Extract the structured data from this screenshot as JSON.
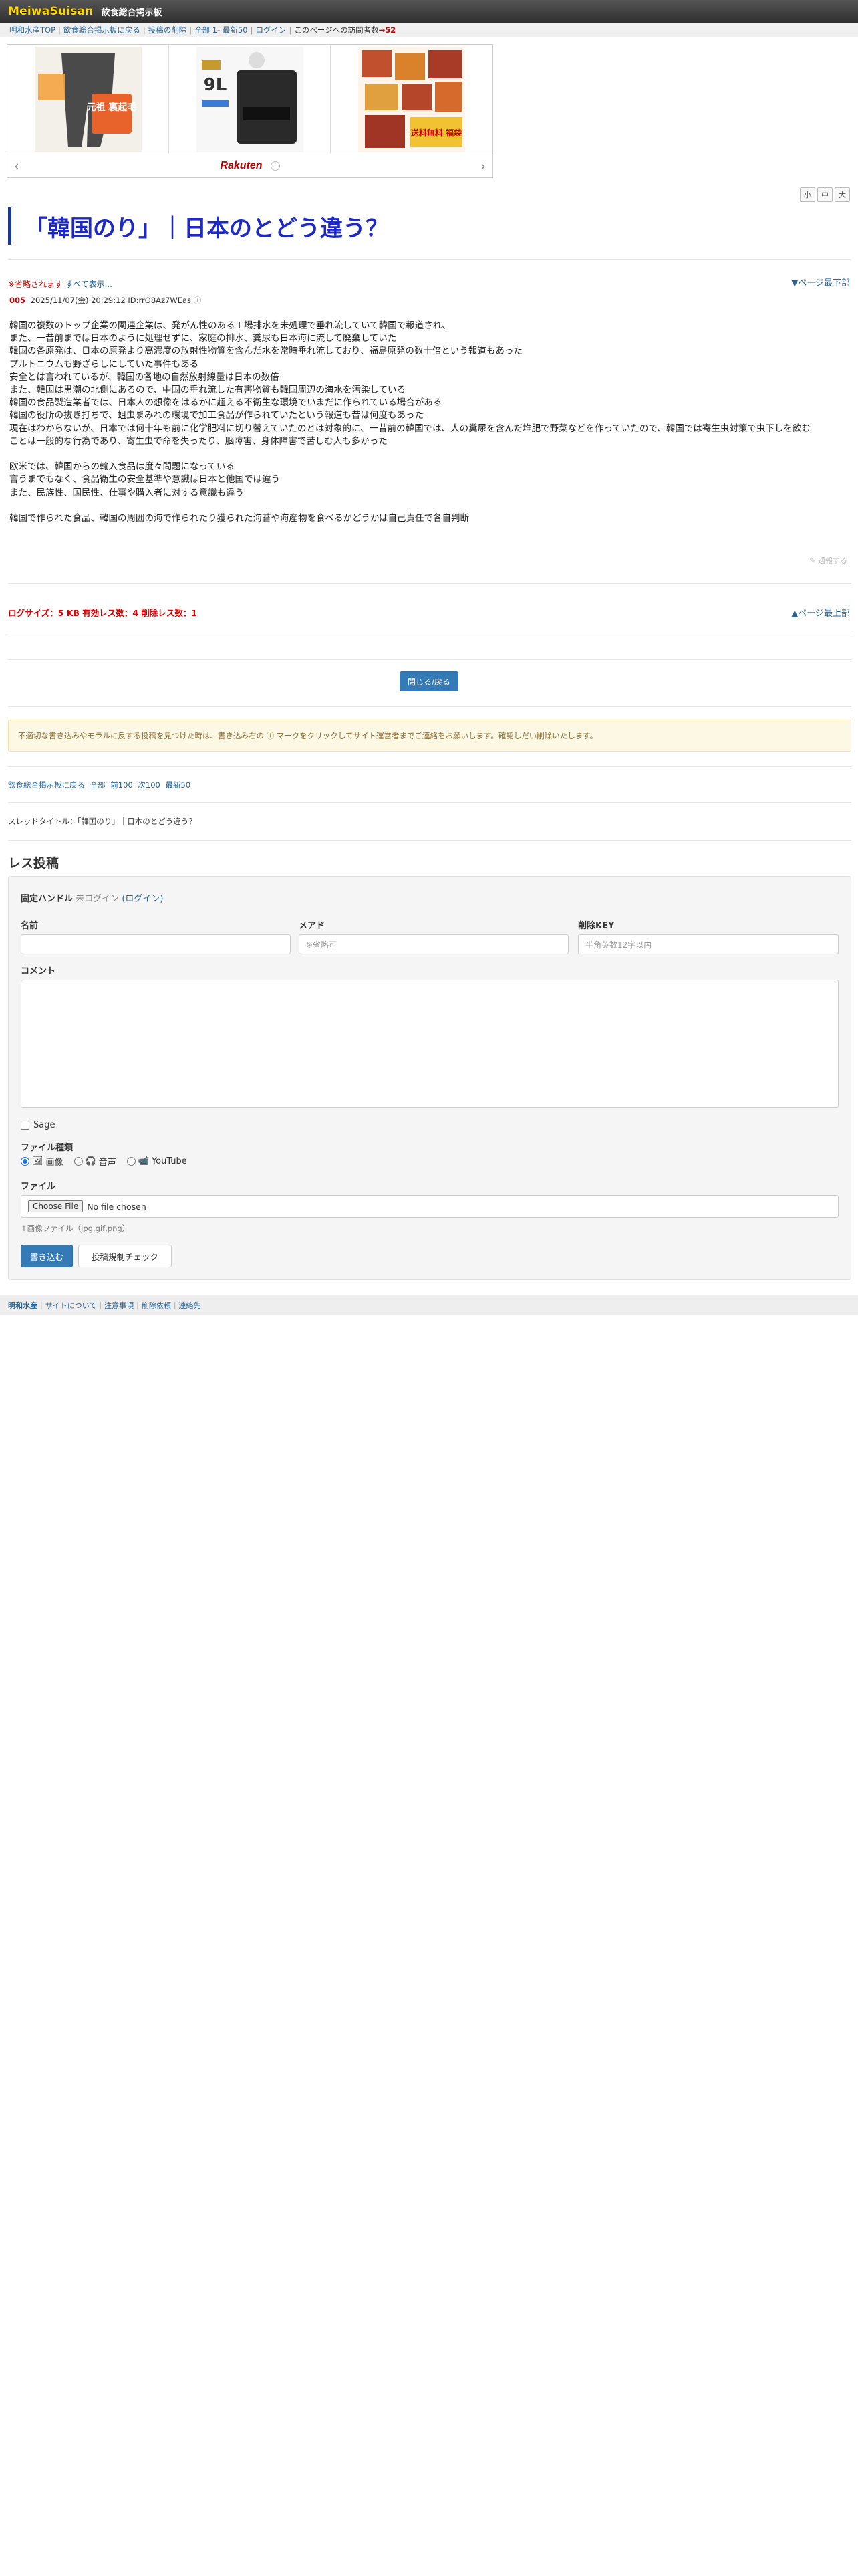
{
  "header": {
    "logo": "MeiwaSuisan",
    "board_name": "飲食総合掲示板"
  },
  "nav": {
    "items": [
      "明和水産TOP",
      "飲食総合掲示板に戻る",
      "投稿の削除",
      "全部",
      "1-",
      "最新50",
      "ログイン"
    ],
    "visitor_label": "このページへの訪問者数",
    "visitor_count": "→52"
  },
  "ad": {
    "brand": "Rakuten",
    "items": [
      "ad-item-leggings",
      "ad-item-humidifier",
      "ad-item-food-set"
    ],
    "humidifier_badge": "9L",
    "leggings_text": "元祖 裏起毛",
    "food_text": "送料無料 福袋"
  },
  "font_sizes": [
    "小",
    "中",
    "大"
  ],
  "thread": {
    "title": "「韓国のり」｜日本のとどう違う？",
    "omitted_label": "※省略されます",
    "show_all": "すべて表示...",
    "page_bottom": "▼ページ最下部",
    "page_top": "▲ページ最上部"
  },
  "post": {
    "number": "005",
    "date": "2025/11/07(金) 20:29:12",
    "id": "ID:rrO8Az7WEas",
    "body_lines": [
      "韓国の複数のトップ企業の関連企業は、発がん性のある工場排水を未処理で垂れ流していて韓国で報道され、",
      "また、一昔前までは日本のように処理せずに、家庭の排水、糞尿も日本海に流して廃棄していた",
      "韓国の各原発は、日本の原発より高濃度の放射性物質を含んだ水を常時垂れ流しており、福島原発の数十倍という報道もあった",
      "プルトニウムも野ざらしにしていた事件もある",
      "安全とは言われているが、韓国の各地の自然放射線量は日本の数倍",
      "また、韓国は黒潮の北側にあるので、中国の垂れ流した有害物質も韓国周辺の海水を汚染している",
      "韓国の食品製造業者では、日本人の想像をはるかに超える不衛生な環境でいまだに作られている場合がある",
      "韓国の役所の抜き打ちで、蛆虫まみれの環境で加工食品が作られていたという報道も昔は何度もあった",
      "現在はわからないが、日本では何十年も前に化学肥料に切り替えていたのとは対象的に、一昔前の韓国では、人の糞尿を含んだ堆肥で野菜などを作っていたので、韓国では寄生虫対策で虫下しを飲む",
      "ことは一般的な行為であり、寄生虫で命を失ったり、脳障害、身体障害で苦しむ人も多かった",
      "",
      "欧米では、韓国からの輸入食品は度々問題になっている",
      "言うまでもなく、食品衛生の安全基準や意識は日本と他国では違う",
      "また、民族性、国民性、仕事や購入者に対する意識も違う",
      "",
      "韓国で作られた食品、韓国の周囲の海で作られたり獲られた海苔や海産物を食べるかどうかは自己責任で各自判断"
    ],
    "report": "通報する"
  },
  "stats": {
    "logsize": "ログサイズ：5 KB 有効レス数：4 削除レス数：1"
  },
  "close_button": "閉じる/戻る",
  "notice": "不適切な書き込みやモラルに反する投稿を見つけた時は、書き込み右の ⓘ マークをクリックしてサイト運営者までご連絡をお願いします。確認しだい削除いたします。",
  "back_links": [
    "飲食総合掲示板に戻る",
    "全部",
    "前100",
    "次100",
    "最新50"
  ],
  "thread_title_line": "スレッドタイトル：「韓国のり」｜日本のとどう違う？",
  "form": {
    "heading": "レス投稿",
    "handle_label": "固定ハンドル",
    "handle_status": "未ログイン",
    "login_link": "(ログイン)",
    "name_label": "名前",
    "mail_label": "メアド",
    "mail_placeholder": "※省略可",
    "delkey_label": "削除KEY",
    "delkey_placeholder": "半角英数12字以内",
    "comment_label": "コメント",
    "sage_label": "Sage",
    "filetype_label": "ファイル種類",
    "filetype_options": [
      "画像",
      "音声",
      "YouTube"
    ],
    "file_label": "ファイル",
    "file_button": "Choose File",
    "file_status": "No file chosen",
    "file_hint": "↑画像ファイル（jpg,gif,png）",
    "submit": "書き込む",
    "check": "投稿規制チェック"
  },
  "footer": {
    "brand": "明和水産",
    "links": [
      "サイトについて",
      "注意事項",
      "削除依頼",
      "連絡先"
    ]
  },
  "colors": {
    "title_blue": "#1d29c5",
    "accent_red": "#cc0000",
    "button_blue": "#337ab7"
  }
}
